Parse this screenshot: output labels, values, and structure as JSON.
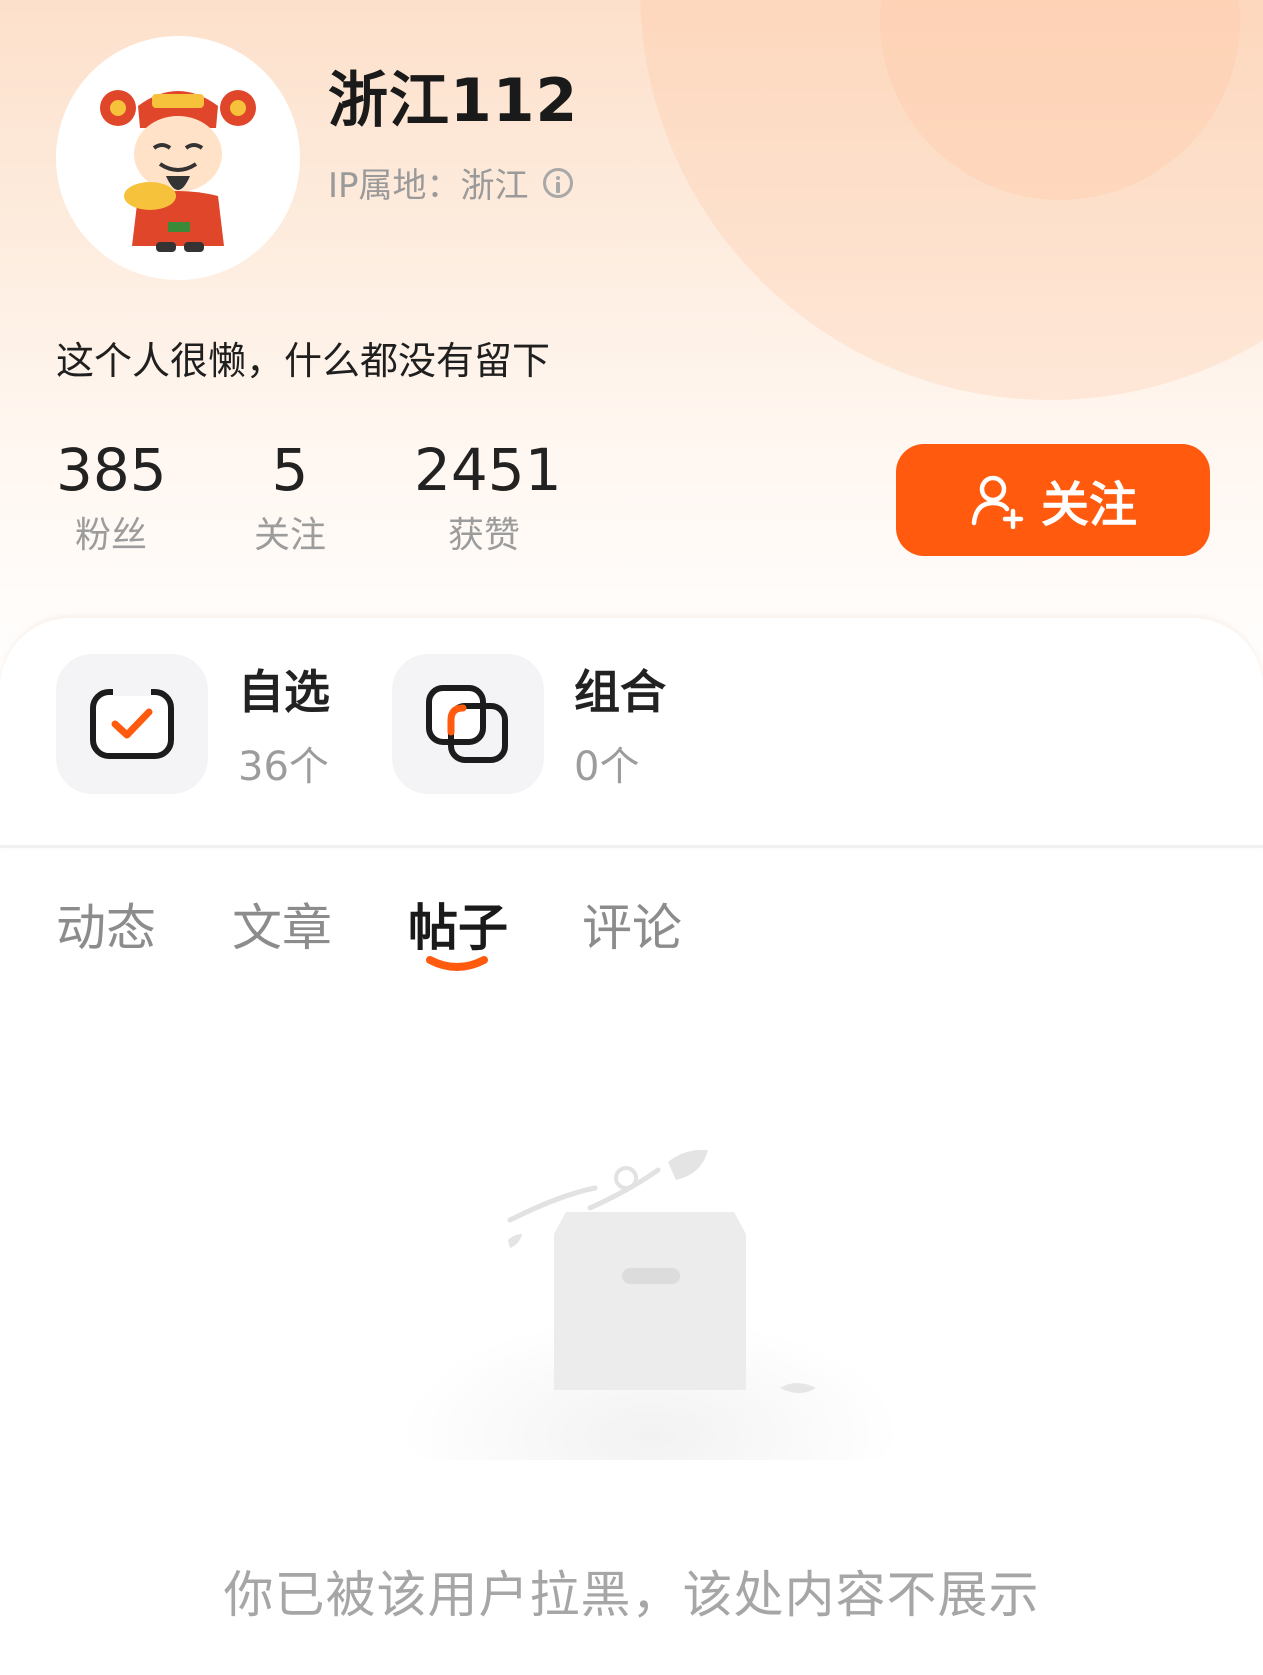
{
  "profile": {
    "username": "浙江112",
    "ip_location": "IP属地：浙江",
    "bio": "这个人很懒，什么都没有留下",
    "avatar_icon": "fortune-god-avatar"
  },
  "stats": [
    {
      "value": "385",
      "label": "粉丝"
    },
    {
      "value": "5",
      "label": "关注"
    },
    {
      "value": "2451",
      "label": "获赞"
    }
  ],
  "follow_button": {
    "label": "关注",
    "icon": "add-user-icon",
    "color": "#ff5a0e"
  },
  "shortcuts": [
    {
      "title": "自选",
      "count": "36个",
      "icon": "checked-box-icon"
    },
    {
      "title": "组合",
      "count": "0个",
      "icon": "overlapping-squares-icon"
    }
  ],
  "tabs": [
    {
      "label": "动态",
      "active": false
    },
    {
      "label": "文章",
      "active": false
    },
    {
      "label": "帖子",
      "active": true
    },
    {
      "label": "评论",
      "active": false
    }
  ],
  "empty_state": {
    "message": "你已被该用户拉黑，该处内容不展示",
    "icon": "empty-box-icon"
  },
  "colors": {
    "accent": "#ff5a0e",
    "muted": "#9c9c9c"
  }
}
